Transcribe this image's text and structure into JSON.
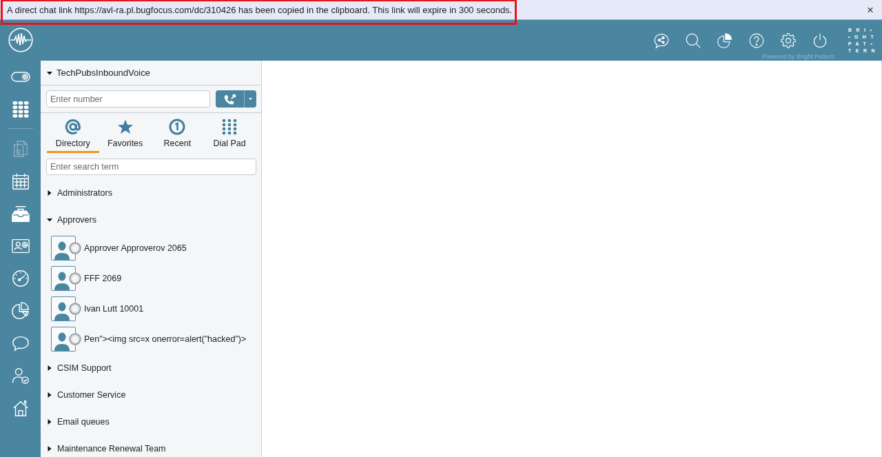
{
  "notification": {
    "text": "A direct chat link https://avl-ra.pl.bugfocus.com/dc/310426 has been copied in the clipboard. This link will expire in 300 seconds.",
    "highlighted": true,
    "close_label": "×"
  },
  "header": {
    "powered_by": "Powered by Bright Pattern",
    "brand": [
      "BRI•",
      "•GHT",
      "PAT•",
      "TERN"
    ]
  },
  "nav": {
    "items": [
      {
        "disabled": false
      },
      {
        "disabled": false
      },
      {
        "disabled": true
      },
      {
        "disabled": false
      },
      {
        "disabled": false
      },
      {
        "disabled": false
      },
      {
        "disabled": false
      },
      {
        "disabled": false
      },
      {
        "disabled": false
      },
      {
        "disabled": false
      },
      {
        "disabled": false
      }
    ]
  },
  "panel": {
    "service": {
      "name": "TechPubsInboundVoice",
      "expanded": true
    },
    "number": {
      "placeholder": "Enter number"
    },
    "tabs": [
      {
        "label": "Directory",
        "selected": true
      },
      {
        "label": "Favorites",
        "selected": false
      },
      {
        "label": "Recent",
        "selected": false
      },
      {
        "label": "Dial Pad",
        "selected": false
      }
    ],
    "search": {
      "placeholder": "Enter search term"
    },
    "groups": [
      {
        "name": "Administrators",
        "expanded": false
      },
      {
        "name": "Approvers",
        "expanded": true,
        "children": [
          {
            "name": "Approver Approverov 2065",
            "available": false
          },
          {
            "name": "FFF 2069",
            "available": false
          },
          {
            "name": "Ivan Lutt 10001",
            "available": false
          },
          {
            "name": "Pen\"><img src=x onerror=alert(\"hacked\")>",
            "available": false
          }
        ]
      },
      {
        "name": "CSIM Support",
        "expanded": false
      },
      {
        "name": "Customer Service",
        "expanded": false
      },
      {
        "name": "Email queues",
        "expanded": false
      },
      {
        "name": "Maintenance Renewal Team",
        "expanded": false
      }
    ]
  }
}
